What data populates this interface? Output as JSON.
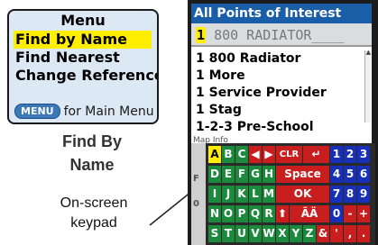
{
  "menu": {
    "title": "Menu",
    "items": [
      {
        "label": "Find by Name",
        "selected": true
      },
      {
        "label": "Find Nearest",
        "selected": false
      },
      {
        "label": "Change Reference",
        "selected": false
      }
    ],
    "footer_key": "MENU",
    "footer_text": "for Main Menu"
  },
  "captions": {
    "main_line1": "Find By",
    "main_line2": "Name",
    "keypad_line1": "On-screen",
    "keypad_line2": "keypad"
  },
  "screen": {
    "title": "All Points of Interest",
    "entry": {
      "cursor_char": "1",
      "text": "800 RADIATOR____"
    },
    "results": [
      "1 800 Radiator",
      "1 More",
      "1 Service Provider",
      "1 Stag",
      "1-2-3 Pre-School"
    ],
    "info_label": "Map Info",
    "strip_chars": [
      "F",
      "0"
    ]
  },
  "keypad": {
    "rows": [
      [
        {
          "label": "A",
          "style": "sel",
          "span": 1
        },
        {
          "label": "B",
          "style": "green",
          "span": 1
        },
        {
          "label": "C",
          "style": "green",
          "span": 1
        },
        {
          "label": "◀",
          "style": "red",
          "span": 1,
          "icon": "arrow-left-icon"
        },
        {
          "label": "▶",
          "style": "red",
          "span": 1,
          "icon": "arrow-right-icon"
        },
        {
          "label": "CLR",
          "style": "red",
          "span": 2
        },
        {
          "label": "↵",
          "style": "red",
          "span": 2,
          "icon": "enter-icon"
        },
        {
          "label": "1",
          "style": "blue",
          "span": 1
        },
        {
          "label": "2",
          "style": "blue",
          "span": 1
        },
        {
          "label": "3",
          "style": "blue",
          "span": 1
        }
      ],
      [
        {
          "label": "D",
          "style": "green",
          "span": 1
        },
        {
          "label": "E",
          "style": "green",
          "span": 1
        },
        {
          "label": "F",
          "style": "green",
          "span": 1
        },
        {
          "label": "G",
          "style": "green",
          "span": 1
        },
        {
          "label": "H",
          "style": "green",
          "span": 1
        },
        {
          "label": "Space",
          "style": "red",
          "span": 4
        },
        {
          "label": "4",
          "style": "blue",
          "span": 1
        },
        {
          "label": "5",
          "style": "blue",
          "span": 1
        },
        {
          "label": "6",
          "style": "blue",
          "span": 1
        }
      ],
      [
        {
          "label": "I",
          "style": "green",
          "span": 1
        },
        {
          "label": "J",
          "style": "green",
          "span": 1
        },
        {
          "label": "K",
          "style": "green",
          "span": 1
        },
        {
          "label": "L",
          "style": "green",
          "span": 1
        },
        {
          "label": "M",
          "style": "green",
          "span": 1
        },
        {
          "label": "OK",
          "style": "red",
          "span": 4
        },
        {
          "label": "7",
          "style": "blue",
          "span": 1
        },
        {
          "label": "8",
          "style": "blue",
          "span": 1
        },
        {
          "label": "9",
          "style": "blue",
          "span": 1
        }
      ],
      [
        {
          "label": "N",
          "style": "green",
          "span": 1
        },
        {
          "label": "O",
          "style": "green",
          "span": 1
        },
        {
          "label": "P",
          "style": "green",
          "span": 1
        },
        {
          "label": "Q",
          "style": "green",
          "span": 1
        },
        {
          "label": "R",
          "style": "green",
          "span": 1
        },
        {
          "label": "⬆",
          "style": "red",
          "span": 1,
          "icon": "shift-icon"
        },
        {
          "label": "ÃÄ",
          "style": "red",
          "span": 3
        },
        {
          "label": "0",
          "style": "blue",
          "span": 1
        },
        {
          "label": "-",
          "style": "red",
          "span": 1
        },
        {
          "label": "+",
          "style": "red",
          "span": 1
        }
      ],
      [
        {
          "label": "S",
          "style": "green",
          "span": 1
        },
        {
          "label": "T",
          "style": "green",
          "span": 1
        },
        {
          "label": "U",
          "style": "green",
          "span": 1
        },
        {
          "label": "V",
          "style": "green",
          "span": 1
        },
        {
          "label": "W",
          "style": "green",
          "span": 1
        },
        {
          "label": "X",
          "style": "green",
          "span": 1
        },
        {
          "label": "Y",
          "style": "green",
          "span": 1
        },
        {
          "label": "Z",
          "style": "green",
          "span": 1
        },
        {
          "label": "&",
          "style": "red",
          "span": 1
        },
        {
          "label": "'",
          "style": "red",
          "span": 1
        },
        {
          "label": ",",
          "style": "red",
          "span": 1
        },
        {
          "label": ".",
          "style": "red",
          "span": 1
        }
      ]
    ]
  },
  "colors": {
    "title_bar": "#1a5ea8",
    "highlight": "#ffee00",
    "key_green": "#1c8a3c",
    "key_red": "#c81e1e",
    "key_blue": "#1830b8"
  }
}
